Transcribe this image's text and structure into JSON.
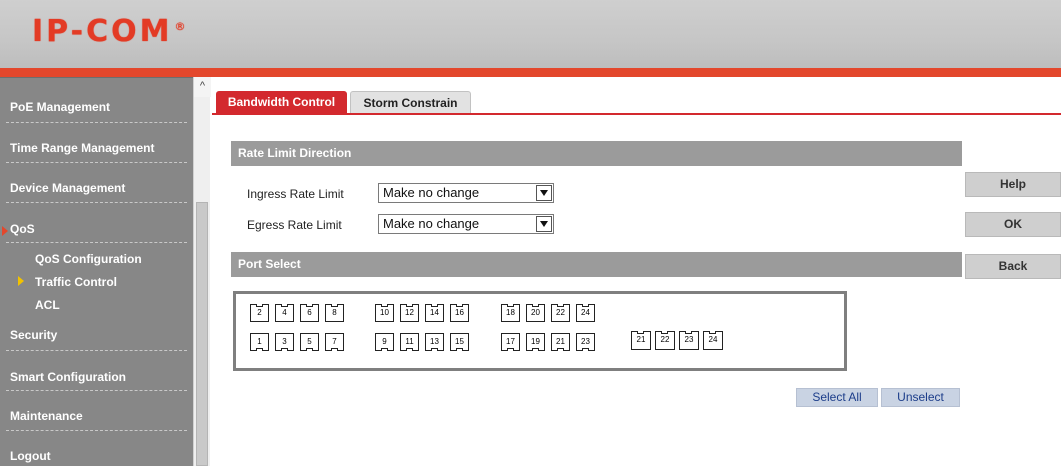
{
  "header": {
    "logo_text": "IP-COM",
    "logo_mark": "®",
    "brand_color": "#e33b25",
    "accent_bar_color": "#e3472c"
  },
  "sidebar": {
    "items": [
      {
        "label": "PoE Management"
      },
      {
        "label": "Time Range Management"
      },
      {
        "label": "Device Management"
      },
      {
        "label": "QoS"
      },
      {
        "label": "Security"
      },
      {
        "label": "Smart Configuration"
      },
      {
        "label": "Maintenance"
      },
      {
        "label": "Logout"
      }
    ],
    "qos_subitems": [
      {
        "label": "QoS Configuration"
      },
      {
        "label": "Traffic Control"
      },
      {
        "label": "ACL"
      }
    ],
    "active_item": "QoS",
    "active_subitem": "Traffic Control",
    "marker_color": "#f2c200"
  },
  "scrollbar": {
    "up_arrow": "^"
  },
  "tabs": [
    {
      "label": "Bandwidth Control",
      "active": true
    },
    {
      "label": "Storm Constrain",
      "active": false
    }
  ],
  "rate_limit": {
    "title": "Rate Limit Direction",
    "ingress_label": "Ingress Rate Limit",
    "ingress_value": "Make no change",
    "egress_label": "Egress Rate Limit",
    "egress_value": "Make no change"
  },
  "port_select": {
    "title": "Port Select",
    "top_row": [
      "2",
      "4",
      "6",
      "8",
      "10",
      "12",
      "14",
      "16",
      "18",
      "20",
      "22",
      "24"
    ],
    "bottom_row": [
      "1",
      "3",
      "5",
      "7",
      "9",
      "11",
      "13",
      "15",
      "17",
      "19",
      "21",
      "23"
    ],
    "sfp_ports": [
      "21",
      "22",
      "23",
      "24"
    ]
  },
  "buttons": {
    "help": "Help",
    "ok": "OK",
    "back": "Back",
    "select_all": "Select All",
    "unselect": "Unselect"
  }
}
